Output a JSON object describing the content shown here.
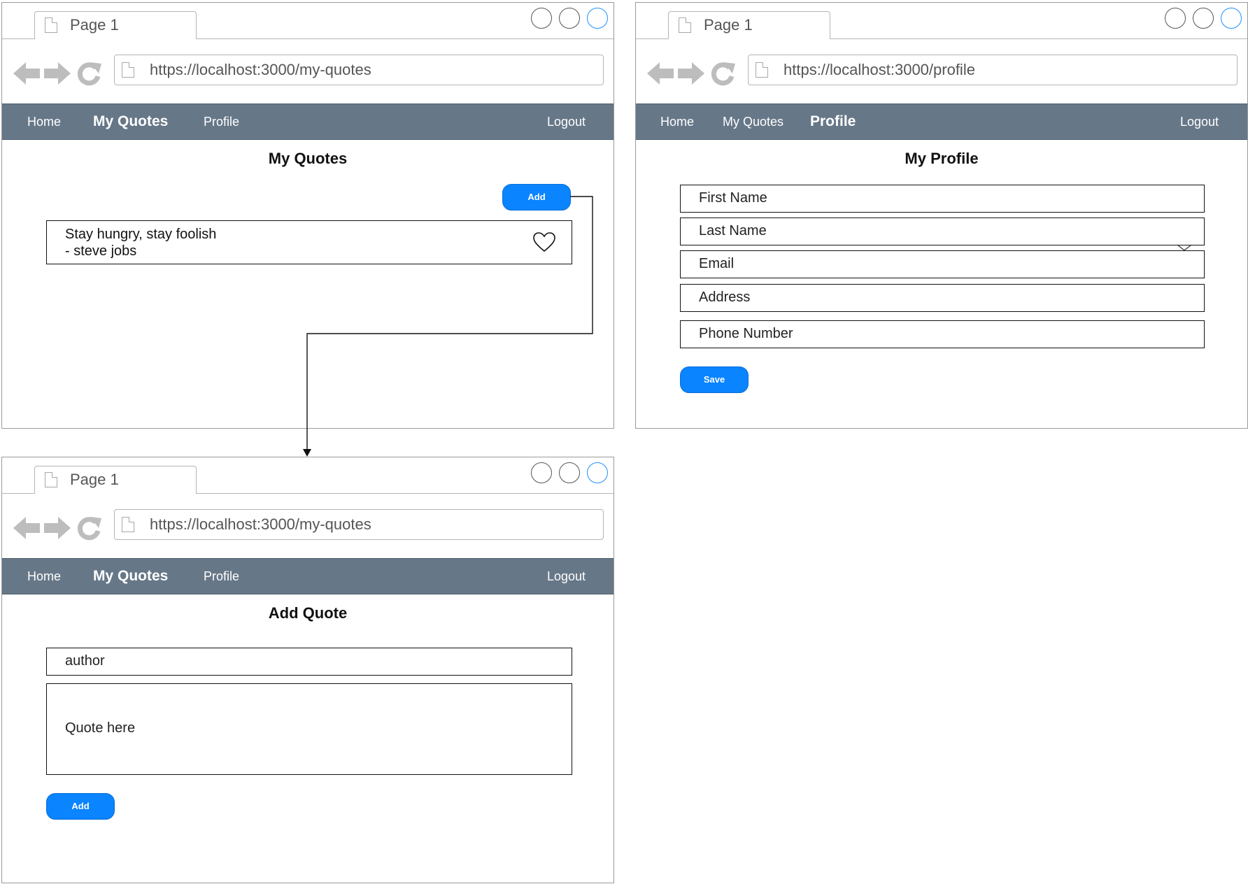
{
  "windows": {
    "quotes": {
      "tab_label": "Page 1",
      "url": "https://localhost:3000/my-quotes",
      "menu": {
        "home": "Home",
        "my_quotes": "My Quotes",
        "profile": "Profile",
        "logout": "Logout"
      },
      "title": "My Quotes",
      "add_button": "Add",
      "quote": {
        "text": "Stay hungry, stay foolish",
        "author": "- steve jobs"
      }
    },
    "profile": {
      "tab_label": "Page 1",
      "url": "https://localhost:3000/profile",
      "menu": {
        "home": "Home",
        "my_quotes": "My Quotes",
        "profile": "Profile",
        "logout": "Logout"
      },
      "title": "My Profile",
      "fields": [
        "First Name",
        "Last Name",
        "Email",
        "Address",
        "Phone Number"
      ],
      "save_button": "Save"
    },
    "add_quote": {
      "tab_label": "Page 1",
      "url": "https://localhost:3000/my-quotes",
      "menu": {
        "home": "Home",
        "my_quotes": "My Quotes",
        "profile": "Profile",
        "logout": "Logout"
      },
      "title": "Add Quote",
      "author_placeholder": "author",
      "quote_placeholder": "Quote here",
      "add_button": "Add"
    }
  },
  "colors": {
    "menubar": "#667788",
    "button": "#0a84ff",
    "active_window_button": "#1e90ff"
  }
}
